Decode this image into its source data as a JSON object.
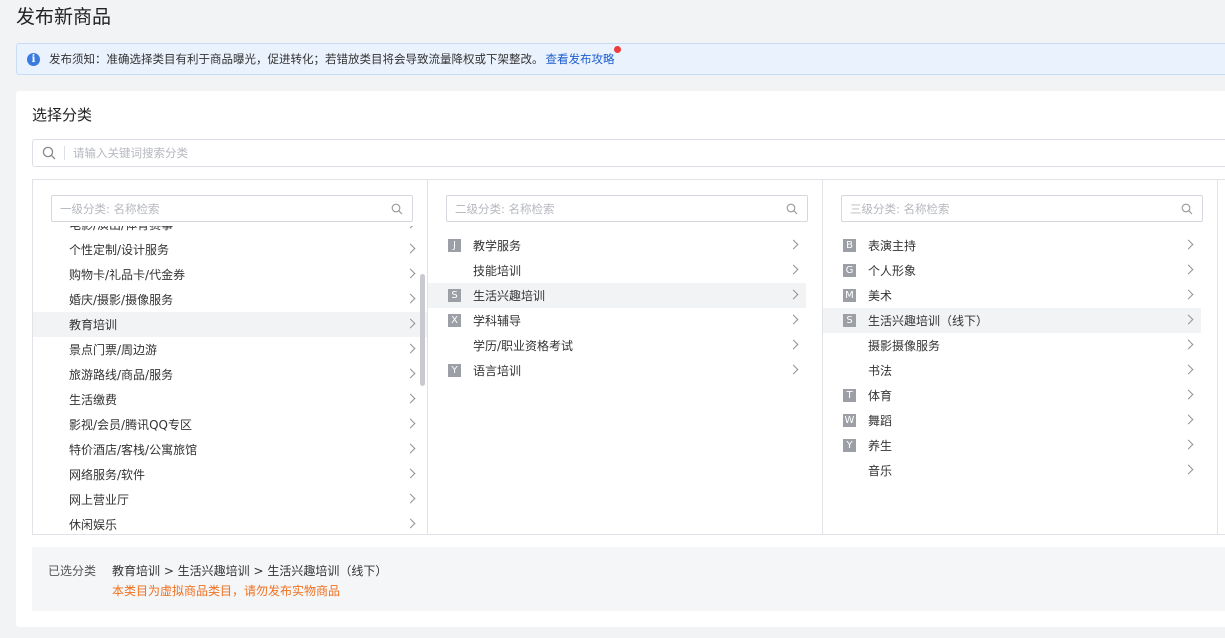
{
  "page_title": "发布新商品",
  "notice": {
    "text": "发布须知：准确选择类目有利于商品曝光，促进转化；若错放类目将会导致流量降权或下架整改。",
    "link": "查看发布攻略"
  },
  "panel": {
    "title": "选择分类",
    "search_placeholder": "请输入关键词搜索分类"
  },
  "columns": {
    "level1": {
      "placeholder": "一级分类: 名称检索",
      "partial_top": "电影/演出/体育赛事",
      "items": [
        {
          "label": "个性定制/设计服务",
          "active": false
        },
        {
          "label": "购物卡/礼品卡/代金券",
          "active": false
        },
        {
          "label": "婚庆/摄影/摄像服务",
          "active": false
        },
        {
          "label": "教育培训",
          "active": true
        },
        {
          "label": "景点门票/周边游",
          "active": false
        },
        {
          "label": "旅游路线/商品/服务",
          "active": false
        },
        {
          "label": "生活缴费",
          "active": false
        },
        {
          "label": "影视/会员/腾讯QQ专区",
          "active": false
        },
        {
          "label": "特价酒店/客栈/公寓旅馆",
          "active": false
        },
        {
          "label": "网络服务/软件",
          "active": false
        },
        {
          "label": "网上营业厅",
          "active": false
        }
      ],
      "partial_bottom": "休闲娱乐"
    },
    "level2": {
      "placeholder": "二级分类: 名称检索",
      "items": [
        {
          "letter": "J",
          "label": "教学服务",
          "active": false
        },
        {
          "letter": "",
          "label": "技能培训",
          "active": false
        },
        {
          "letter": "S",
          "label": "生活兴趣培训",
          "active": true
        },
        {
          "letter": "X",
          "label": "学科辅导",
          "active": false
        },
        {
          "letter": "",
          "label": "学历/职业资格考试",
          "active": false
        },
        {
          "letter": "Y",
          "label": "语言培训",
          "active": false
        }
      ]
    },
    "level3": {
      "placeholder": "三级分类: 名称检索",
      "items": [
        {
          "letter": "B",
          "label": "表演主持",
          "active": false
        },
        {
          "letter": "G",
          "label": "个人形象",
          "active": false
        },
        {
          "letter": "M",
          "label": "美术",
          "active": false
        },
        {
          "letter": "S",
          "label": "生活兴趣培训（线下）",
          "active": true
        },
        {
          "letter": "",
          "label": "摄影摄像服务",
          "active": false
        },
        {
          "letter": "",
          "label": "书法",
          "active": false
        },
        {
          "letter": "T",
          "label": "体育",
          "active": false
        },
        {
          "letter": "W",
          "label": "舞蹈",
          "active": false
        },
        {
          "letter": "Y",
          "label": "养生",
          "active": false
        },
        {
          "letter": "",
          "label": "音乐",
          "active": false
        }
      ]
    }
  },
  "selected": {
    "label": "已选分类",
    "path": "教育培训 > 生活兴趣培训 > 生活兴趣培训（线下）",
    "warning": "本类目为虚拟商品类目，请勿发布实物商品"
  },
  "colors": {
    "accent": "#1d5fd0",
    "warning": "#f0701e",
    "badge_dot": "#ee3b3b",
    "letter_badge": "#9c9fa5"
  }
}
